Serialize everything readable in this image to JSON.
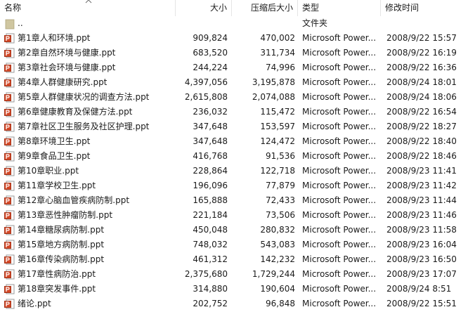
{
  "columns": {
    "name": "名称",
    "size": "大小",
    "compressed": "压缩后大小",
    "type": "类型",
    "modified": "修改时间"
  },
  "parent": {
    "name": "..",
    "type": "文件夹"
  },
  "files": [
    {
      "name": "第1章人和环境.ppt",
      "size": "909,824",
      "compressed": "470,002",
      "type": "Microsoft Power...",
      "modified": "2008/9/22 15:57"
    },
    {
      "name": "第2章自然环境与健康.ppt",
      "size": "683,520",
      "compressed": "311,734",
      "type": "Microsoft Power...",
      "modified": "2008/9/22 16:19"
    },
    {
      "name": "第3章社会环境与健康.ppt",
      "size": "244,224",
      "compressed": "74,996",
      "type": "Microsoft Power...",
      "modified": "2008/9/22 16:36"
    },
    {
      "name": "第4章人群健康研究.ppt",
      "size": "4,397,056",
      "compressed": "3,195,878",
      "type": "Microsoft Power...",
      "modified": "2008/9/24 18:01"
    },
    {
      "name": "第5章人群健康状况的调查方法.ppt",
      "size": "2,615,808",
      "compressed": "2,074,088",
      "type": "Microsoft Power...",
      "modified": "2008/9/24 18:06"
    },
    {
      "name": "第6章健康教育及保健方法.ppt",
      "size": "236,032",
      "compressed": "115,472",
      "type": "Microsoft Power...",
      "modified": "2008/9/22 16:54"
    },
    {
      "name": "第7章社区卫生服务及社区护理.ppt",
      "size": "347,648",
      "compressed": "153,597",
      "type": "Microsoft Power...",
      "modified": "2008/9/22 18:27"
    },
    {
      "name": "第8章环境卫生.ppt",
      "size": "347,648",
      "compressed": "124,472",
      "type": "Microsoft Power...",
      "modified": "2008/9/22 18:40"
    },
    {
      "name": "第9章食品卫生.ppt",
      "size": "416,768",
      "compressed": "91,536",
      "type": "Microsoft Power...",
      "modified": "2008/9/22 18:46"
    },
    {
      "name": "第10章职业.ppt",
      "size": "228,864",
      "compressed": "122,718",
      "type": "Microsoft Power...",
      "modified": "2008/9/23 11:41"
    },
    {
      "name": "第11章学校卫生.ppt",
      "size": "196,096",
      "compressed": "77,879",
      "type": "Microsoft Power...",
      "modified": "2008/9/23 11:42"
    },
    {
      "name": "第12章心脑血管疾病防制.ppt",
      "size": "165,888",
      "compressed": "72,433",
      "type": "Microsoft Power...",
      "modified": "2008/9/23 11:44"
    },
    {
      "name": "第13章恶性肿瘤防制.ppt",
      "size": "221,184",
      "compressed": "73,506",
      "type": "Microsoft Power...",
      "modified": "2008/9/23 11:46"
    },
    {
      "name": "第14章糖尿病防制.ppt",
      "size": "450,048",
      "compressed": "280,832",
      "type": "Microsoft Power...",
      "modified": "2008/9/23 11:58"
    },
    {
      "name": "第15章地方病防制.ppt",
      "size": "748,032",
      "compressed": "543,083",
      "type": "Microsoft Power...",
      "modified": "2008/9/23 16:04"
    },
    {
      "name": "第16章传染病防制.ppt",
      "size": "461,312",
      "compressed": "142,232",
      "type": "Microsoft Power...",
      "modified": "2008/9/23 16:50"
    },
    {
      "name": "第17章性病防治.ppt",
      "size": "2,375,680",
      "compressed": "1,729,244",
      "type": "Microsoft Power...",
      "modified": "2008/9/23 17:07"
    },
    {
      "name": "第18章突发事件.ppt",
      "size": "314,880",
      "compressed": "190,604",
      "type": "Microsoft Power...",
      "modified": "2008/9/24 8:51"
    },
    {
      "name": "绪论.ppt",
      "size": "202,752",
      "compressed": "96,848",
      "type": "Microsoft Power...",
      "modified": "2008/9/22 15:51"
    }
  ],
  "icons": {
    "file": "powerpoint-file-icon",
    "parent": "folder-up-icon",
    "sort": "sort-ascending-arrow-icon"
  },
  "colors": {
    "ppt_icon": "#d24726",
    "folder_icon": "#cfc6a0",
    "header_divider": "#e5e5e5"
  }
}
